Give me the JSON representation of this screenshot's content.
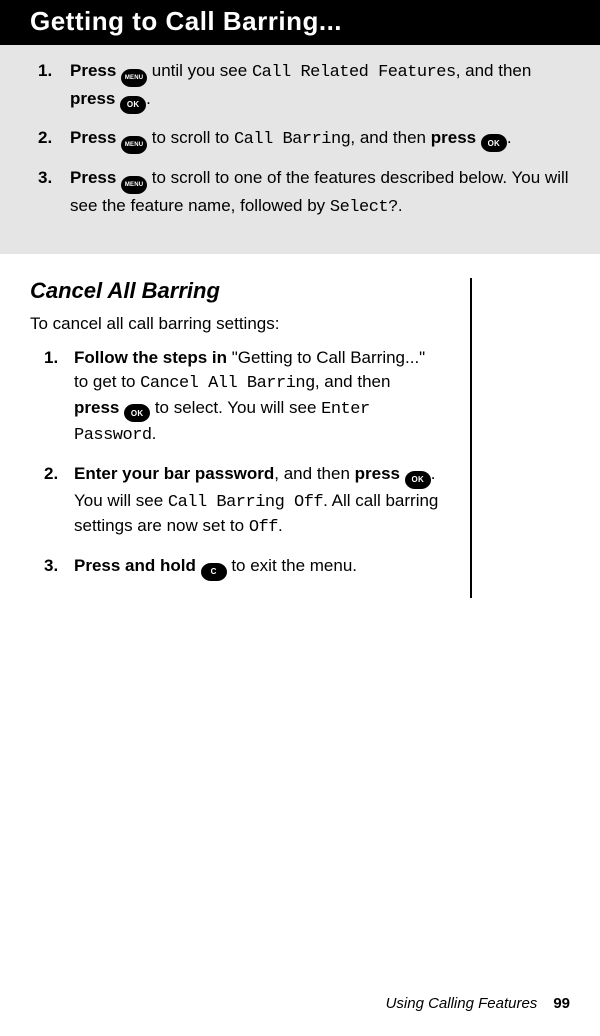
{
  "title": "Getting to Call Barring...",
  "icons": {
    "menu": "MENU",
    "ok": "OK",
    "c": "C"
  },
  "box": {
    "s1": {
      "a": "Press ",
      "b": " until you see ",
      "c": "Call Related Features",
      "d": ", and then ",
      "e": "press ",
      "f": "."
    },
    "s2": {
      "a": "Press ",
      "b": " to scroll to ",
      "c": "Call Barring",
      "d": ", and then ",
      "e": "press ",
      "f": "."
    },
    "s3": {
      "a": "Press ",
      "b": " to scroll to one of the features described below. You will see the feature name, followed by ",
      "c": "Select?",
      "d": "."
    }
  },
  "section": {
    "heading": "Cancel All Barring",
    "intro": "To cancel all call barring settings:",
    "s1": {
      "a": "Follow the steps in ",
      "b": "\"Getting to Call Barring...\" to get to ",
      "c": "Cancel All Barring",
      "d": ", and then ",
      "e": "press ",
      "f": " to select. You will see ",
      "g": "Enter Password",
      "h": "."
    },
    "s2": {
      "a": "Enter your bar password",
      "b": ", and then ",
      "c": "press ",
      "d": ". You will see ",
      "e": "Call Barring Off",
      "f": ". All call barring settings are now set to ",
      "g": "Off",
      "h": "."
    },
    "s3": {
      "a": "Press and hold ",
      "b": " to exit the menu."
    }
  },
  "footer": {
    "section": "Using Calling Features",
    "page": "99"
  }
}
